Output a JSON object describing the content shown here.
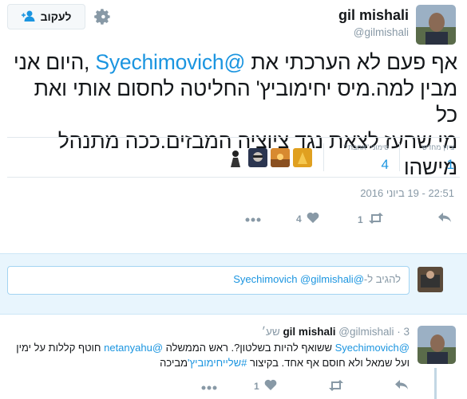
{
  "header": {
    "fullname": "gil mishali",
    "username": "@gilmishali",
    "follow_label": "לעקוב"
  },
  "tweet": {
    "line1_pre": "אף פעם לא הערכתי את ",
    "line1_mention": "@Syechimovich",
    "line1_post": " ,היום אני",
    "line2": "מבין למה.מיס יחימוביץ' החליטה לחסום אותי ואת כל",
    "line3": "מי שהעז לצאת נגד ציוציה המבזים.ככה מתנהל מישהו"
  },
  "stats": {
    "retweets_label": "ציוץ מחדש",
    "retweets_value": "1",
    "likes_label": "סימוני \"אהבתי\"",
    "likes_value": "4"
  },
  "timestamp": "22:51 - 19 ביוני 2016",
  "actions": {
    "retweet_count": "1",
    "like_count": "4"
  },
  "reply_box": {
    "placeholder": "להגיב ל-",
    "mentions": "@Syechimovich @gilmishali"
  },
  "reply_tweet": {
    "name": "gil mishali",
    "username": "@gilmishali",
    "time": "3 שע׳",
    "line1_mention_a": "@Syechimovich",
    "line1_mid": " ששואף להיות בשלטון?. ראש הממשלה ",
    "line1_mention_b": "@netanyahu",
    "line1_post": " חוטף קללות על ימין",
    "line2_pre": "ועל שמאל ולא חוסם אף אחד. בקיצור ",
    "line2_hashtag": "#שלייחימוביץ'",
    "line2_post": "מביכה",
    "retweet_count": "",
    "like_count": "1"
  },
  "colors": {
    "link": "#1b95e0",
    "muted": "#8899a6",
    "reply_bg": "#e8f5fd"
  }
}
